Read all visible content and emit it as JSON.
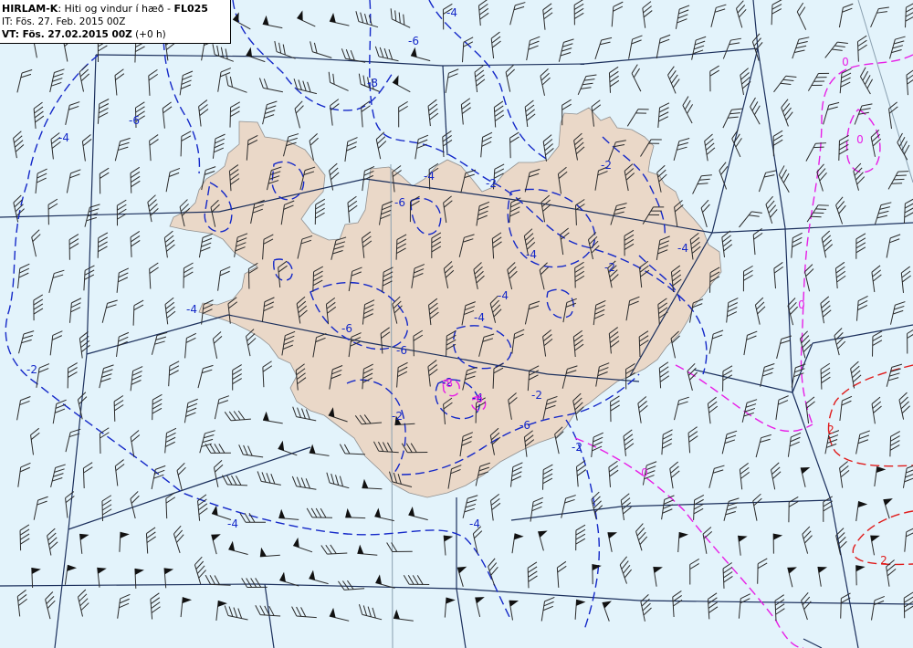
{
  "legend": {
    "model": "HIRLAM-K",
    "title": ": Hiti og vindur í hæð - ",
    "level": "FL025",
    "it_label": "IT: ",
    "it_value": "Fös. 27. Feb. 2015 00Z",
    "vt_label": "VT: ",
    "vt_value": "Fös. 27.02.2015 00Z",
    "vt_offset": " (+0 h)"
  },
  "colors": {
    "sea": "#e3f3fb",
    "land": "#ead8c8",
    "land_outline": "#8f8f8f",
    "graticule": "#1b2f5c",
    "isotherm_negative": "#1428c8",
    "isotherm_zero": "#e81ee6",
    "isotherm_positive": "#e01b1b",
    "wind_barb": "#2a2a2a"
  },
  "contour_labels": [
    {
      "text": "-4",
      "color": "isotherm_negative"
    },
    {
      "text": "-6",
      "color": "isotherm_negative"
    },
    {
      "text": "-8",
      "color": "isotherm_negative"
    },
    {
      "text": "-6",
      "color": "isotherm_negative"
    },
    {
      "text": "-4",
      "color": "isotherm_negative"
    },
    {
      "text": "-4",
      "color": "isotherm_negative"
    },
    {
      "text": "-6",
      "color": "isotherm_negative"
    },
    {
      "text": "-4",
      "color": "isotherm_negative"
    },
    {
      "text": "-2",
      "color": "isotherm_negative"
    },
    {
      "text": "-2",
      "color": "isotherm_negative"
    },
    {
      "text": "-4",
      "color": "isotherm_negative"
    },
    {
      "text": "-2",
      "color": "isotherm_negative"
    },
    {
      "text": "-4",
      "color": "isotherm_negative"
    },
    {
      "text": "-6",
      "color": "isotherm_negative"
    },
    {
      "text": "-6",
      "color": "isotherm_negative"
    },
    {
      "text": "-4",
      "color": "isotherm_negative"
    },
    {
      "text": "-2",
      "color": "isotherm_negative"
    },
    {
      "text": "-4",
      "color": "isotherm_negative"
    },
    {
      "text": "-2",
      "color": "isotherm_negative"
    },
    {
      "text": "-2",
      "color": "isotherm_negative"
    },
    {
      "text": "-4",
      "color": "isotherm_negative"
    },
    {
      "text": "-4",
      "color": "isotherm_negative"
    },
    {
      "text": "-2",
      "color": "isotherm_negative"
    },
    {
      "text": "-4",
      "color": "isotherm_negative"
    },
    {
      "text": "-2",
      "color": "isotherm_negative"
    },
    {
      "text": "-6",
      "color": "isotherm_negative"
    },
    {
      "text": "-8",
      "color": "isotherm_zero"
    },
    {
      "text": "-6",
      "color": "isotherm_zero"
    },
    {
      "text": "0",
      "color": "isotherm_zero"
    },
    {
      "text": "0",
      "color": "isotherm_zero"
    },
    {
      "text": "0",
      "color": "isotherm_zero"
    },
    {
      "text": "0",
      "color": "isotherm_zero"
    },
    {
      "text": "2",
      "color": "isotherm_positive"
    },
    {
      "text": "2",
      "color": "isotherm_positive"
    }
  ]
}
